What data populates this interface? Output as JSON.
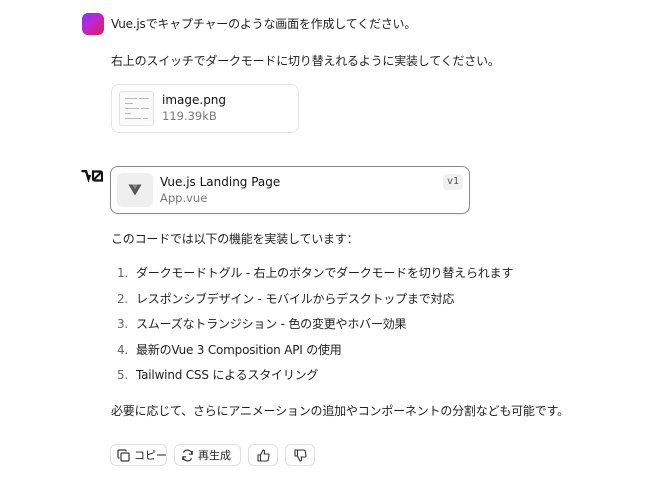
{
  "user_message": {
    "line1": "Vue.jsでキャプチャーのような画面を作成してください。",
    "line2": "右上のスイッチでダークモードに切り替えれるように実装してください。",
    "attachment": {
      "name": "image.png",
      "size": "119.39kB",
      "icon": "image-thumbnail-icon"
    }
  },
  "assistant": {
    "logo": "v0",
    "artifact": {
      "title": "Vue.js Landing Page",
      "file": "App.vue",
      "version": "v1",
      "icon": "vue-logo-icon"
    },
    "intro": "このコードでは以下の機能を実装しています：",
    "features": [
      {
        "num": "1.",
        "text": "ダークモードトグル - 右上のボタンでダークモードを切り替えられます"
      },
      {
        "num": "2.",
        "text": "レスポンシブデザイン - モバイルからデスクトップまで対応"
      },
      {
        "num": "3.",
        "text": "スムーズなトランジション - 色の変更やホバー効果"
      },
      {
        "num": "4.",
        "text": "最新のVue 3 Composition API の使用"
      },
      {
        "num": "5.",
        "text": "Tailwind CSS によるスタイリング"
      }
    ],
    "outro": "必要に応じて、さらにアニメーションの追加やコンポーネントの分割なども可能です。",
    "actions": {
      "copy_label": "コピー",
      "regenerate_label": "再生成",
      "copy_icon": "copy-icon",
      "regenerate_icon": "refresh-icon",
      "like_icon": "thumbs-up-icon",
      "dislike_icon": "thumbs-down-icon"
    }
  },
  "colors": {
    "avatar_gradient_start": "#7c3aed",
    "avatar_gradient_end": "#e11d48",
    "artifact_border": "#8a8a8a",
    "text": "#1f1f1f",
    "muted": "#777777"
  }
}
